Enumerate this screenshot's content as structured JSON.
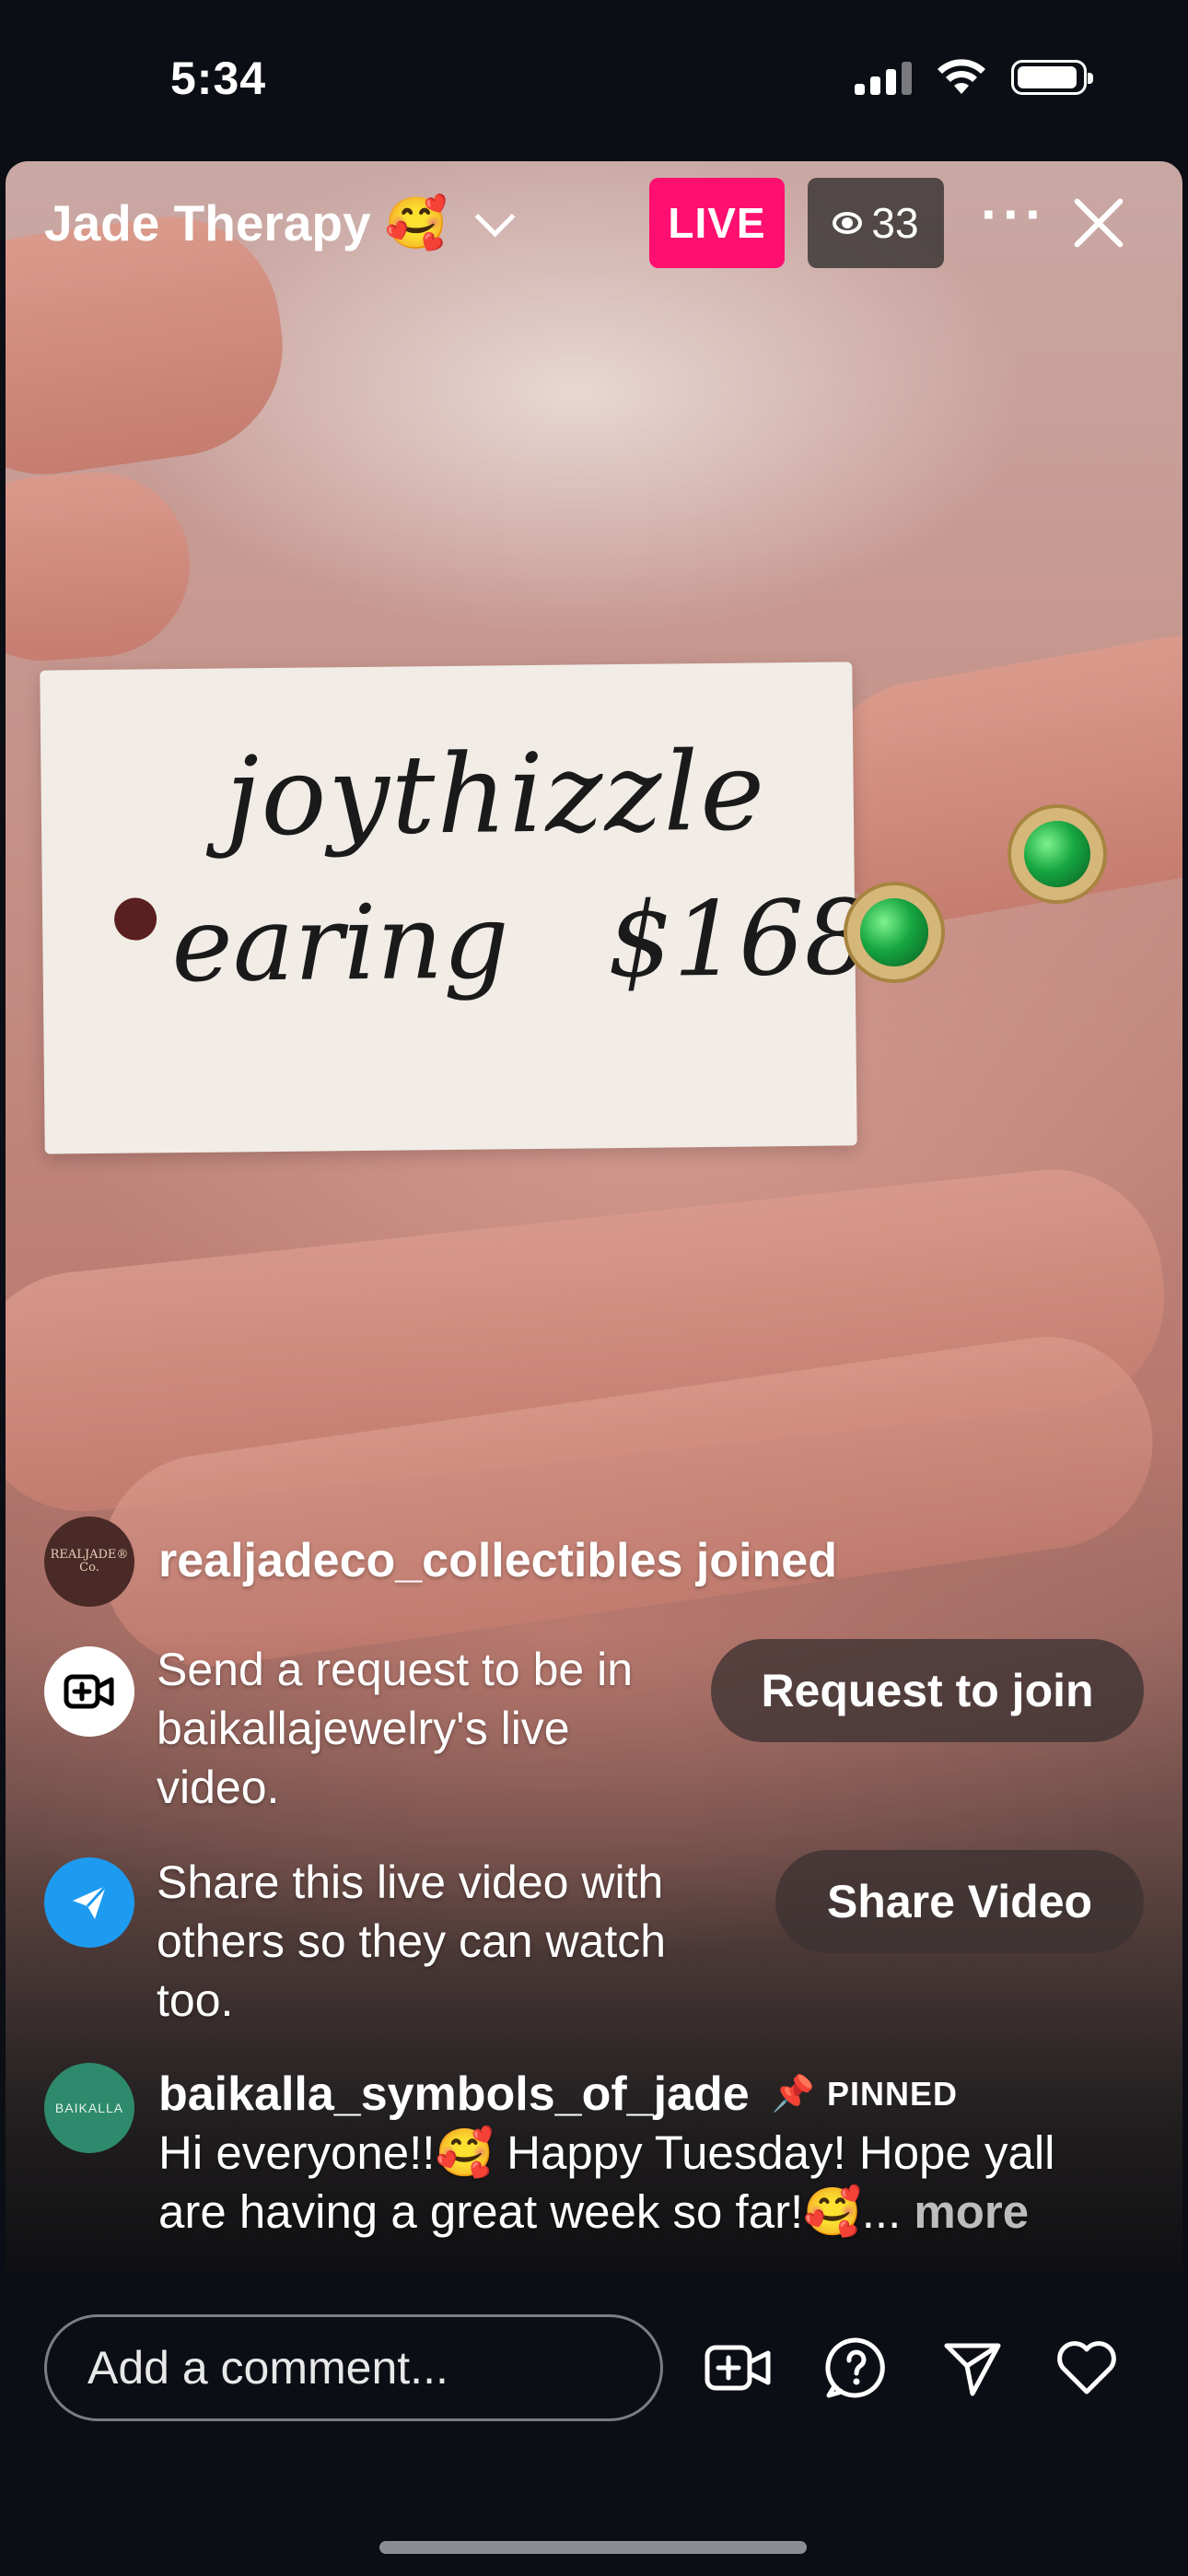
{
  "status_bar": {
    "time": "5:34"
  },
  "live": {
    "title": "Jade Therapy 🥰",
    "badge": "LIVE",
    "viewer_count": "33"
  },
  "video_tag": {
    "line1": "joythizzle",
    "line2": "earing   $1680"
  },
  "feed": {
    "joined": {
      "user": "realjadeco_collectibles",
      "text": "realjadeco_collectibles joined",
      "avatar_text": "REALJADE® Co."
    },
    "request": {
      "text": "Send a request to be in baikallajewelry's live video.",
      "button": "Request to join"
    },
    "share": {
      "text": "Share this live video with others so they can watch too.",
      "button": "Share Video"
    },
    "pinned": {
      "user": "baikalla_symbols_of_jade",
      "label": "PINNED",
      "message": "Hi everyone!!🥰 Happy Tuesday! Hope yall are having a great week so far!🥰...",
      "more": "more",
      "avatar_text": "BAIKALLA"
    }
  },
  "bottom_bar": {
    "comment_placeholder": "Add a comment...",
    "icons": [
      "add-video-icon",
      "question-icon",
      "send-icon",
      "heart-icon"
    ]
  },
  "colors": {
    "live_badge": "#ff0f6f",
    "share_avatar": "#1d9bf0",
    "background": "#0b0e14"
  }
}
